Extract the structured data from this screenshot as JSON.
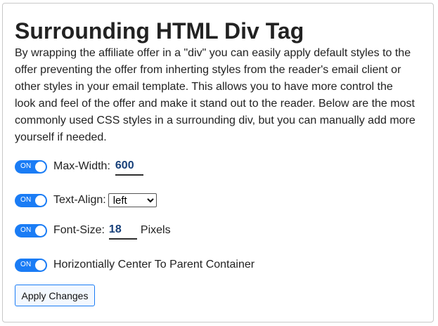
{
  "section": {
    "title": "Surrounding HTML Div Tag",
    "description": "By wrapping the affiliate offer in a \"div\" you can easily apply default styles to the offer preventing the offer from inherting styles from the reader's email client or other styles in your email template. This allows you to have more control the look and feel of the offer and make it stand out to the reader. Below are the most commonly used CSS styles in a surrounding div, but you can manually add more yourself if needed."
  },
  "options": {
    "max_width": {
      "toggle": "ON",
      "label": "Max-Width:",
      "value": "600"
    },
    "text_align": {
      "toggle": "ON",
      "label": "Text-Align:",
      "selected": "left"
    },
    "font_size": {
      "toggle": "ON",
      "label": "Font-Size:",
      "value": "18",
      "unit": "Pixels"
    },
    "center": {
      "toggle": "ON",
      "label": "Horizontially Center To Parent Container"
    }
  },
  "actions": {
    "apply_label": "Apply Changes"
  },
  "colors": {
    "toggle_on": "#1a7cf5",
    "input_text": "#17407a",
    "button_border": "#1a7cf5"
  }
}
